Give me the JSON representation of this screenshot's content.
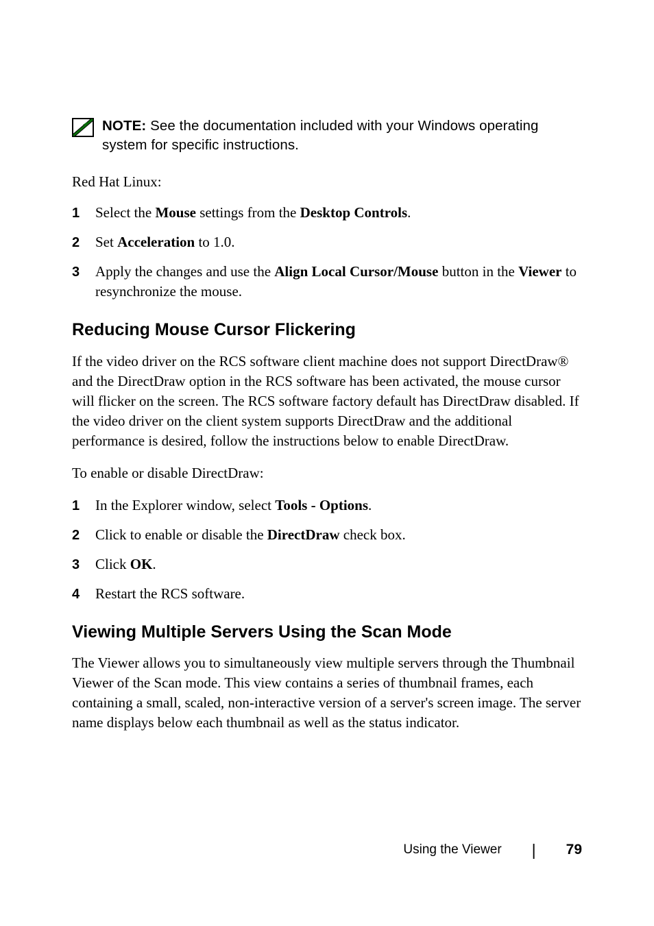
{
  "note": {
    "label": "NOTE:",
    "text": "See the documentation included with your Windows operating system for specific instructions."
  },
  "redhat_intro": "Red Hat Linux:",
  "redhat_steps": [
    {
      "num": "1",
      "pre": "Select the ",
      "b1": "Mouse",
      "mid1": " settings from the ",
      "b2": "Desktop Controls",
      "post": "."
    },
    {
      "num": "2",
      "pre": "Set ",
      "b1": "Acceleration",
      "mid1": " to 1.0.",
      "b2": "",
      "post": ""
    },
    {
      "num": "3",
      "pre": "Apply the changes and use the ",
      "b1": "Align Local Cursor/Mouse",
      "mid1": " button in the ",
      "b2": "Viewer",
      "post": " to resynchronize the mouse."
    }
  ],
  "section1": {
    "title": "Reducing Mouse Cursor Flickering",
    "para": "If the video driver on the RCS software client machine does not support DirectDraw® and the DirectDraw option in the RCS software has been activated, the mouse cursor will flicker on the screen. The RCS software factory default has DirectDraw disabled. If the video driver on the client system supports DirectDraw and the additional performance is desired, follow the instructions below to enable DirectDraw.",
    "intro2": "To enable or disable DirectDraw:",
    "steps": [
      {
        "num": "1",
        "pre": "In the Explorer window, select ",
        "b1": "Tools - Options",
        "post": "."
      },
      {
        "num": "2",
        "pre": "Click to enable or disable the ",
        "b1": "DirectDraw",
        "post": " check box."
      },
      {
        "num": "3",
        "pre": "Click ",
        "b1": "OK",
        "post": "."
      },
      {
        "num": "4",
        "pre": "Restart the RCS software.",
        "b1": "",
        "post": ""
      }
    ]
  },
  "section2": {
    "title": "Viewing Multiple Servers Using the Scan Mode",
    "para": "The Viewer allows you to simultaneously view multiple servers through the Thumbnail Viewer of the Scan mode. This view contains a series of thumbnail frames, each containing a small, scaled, non-interactive version of a server's screen image. The server name displays below each thumbnail as well as the status indicator."
  },
  "footer": {
    "section": "Using the Viewer",
    "page": "79"
  }
}
